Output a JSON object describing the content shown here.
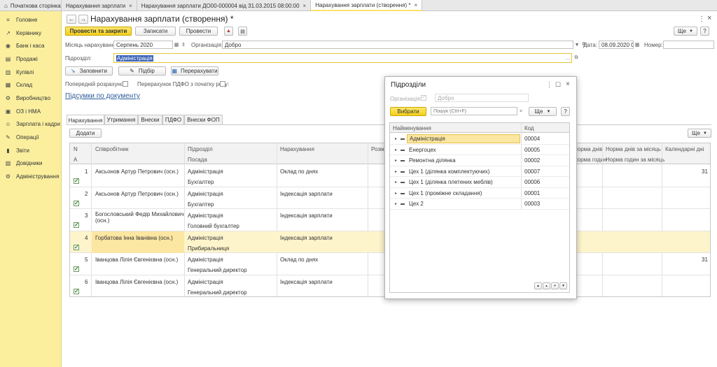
{
  "tabs": [
    {
      "label": "Початкова сторінка",
      "close": ""
    },
    {
      "label": "Нарахування зарплати",
      "close": "×"
    },
    {
      "label": "Нарахування зарплати ДО00-000004 від 31.03.2015 08:00:00",
      "close": "×"
    },
    {
      "label": "Нарахування зарплати (створення) *",
      "close": "×"
    }
  ],
  "sidebar": {
    "items": [
      {
        "label": "Головне",
        "icon": "≡"
      },
      {
        "label": "Керівнику",
        "icon": "↗"
      },
      {
        "label": "Банк і каса",
        "icon": "◉"
      },
      {
        "label": "Продажі",
        "icon": "▤"
      },
      {
        "label": "Купівлі",
        "icon": "▥"
      },
      {
        "label": "Склад",
        "icon": "▦"
      },
      {
        "label": "Виробництво",
        "icon": "⚙"
      },
      {
        "label": "ОЗ і НМА",
        "icon": "▣"
      },
      {
        "label": "Зарплата і кадри",
        "icon": "☺"
      },
      {
        "label": "Операції",
        "icon": "✎"
      },
      {
        "label": "Звіти",
        "icon": "▮"
      },
      {
        "label": "Довідники",
        "icon": "▧"
      },
      {
        "label": "Адміністрування",
        "icon": "⚙"
      }
    ]
  },
  "header": {
    "back": "←",
    "forward": "→",
    "title": "Нарахування зарплати (створення) *",
    "more_dots": "⋮",
    "close": "×"
  },
  "toolbar": {
    "post_close": "Провести та закрити",
    "save": "Записати",
    "post": "Провести",
    "more": "Ще",
    "help": "?"
  },
  "form": {
    "month_label": "Місяць нарахування:",
    "month_value": "Серпень 2020",
    "org_label": "Організація:",
    "org_value": "Добро",
    "date_label": "Дата:",
    "date_value": "08.09.2020 0...",
    "number_label": "Номер:",
    "number_value": "",
    "division_label": "Підрозділ:",
    "division_value": "Адміністрація"
  },
  "actions": {
    "fill": "Заповнити",
    "pick": "Підбір",
    "recalc": "Перерахувати"
  },
  "options": {
    "prelim_label": "Попередній розрахунок:",
    "pdfo_label": "Перерахунок ПДФО з початку року:"
  },
  "summary_link": "Підсумки по документу",
  "doc_tabs": [
    "Нарахування",
    "Утримання",
    "Внески",
    "ПДФО",
    "Внески ФОП"
  ],
  "grid": {
    "add": "Додати",
    "more": "Ще",
    "headers": {
      "n": "N",
      "a": "А",
      "employee": "Співробітник",
      "division": "Підрозділ",
      "position": "Посада",
      "accrual": "Нарахування",
      "size": "Розмі",
      "norm_days": "Норма днів",
      "norm_hours": "Норма годин",
      "norm_days_month": "Норма днів за місяць",
      "norm_hours_month": "Норма годин за місяць",
      "cal_days": "Календарні дні"
    },
    "rows": [
      {
        "n": "1",
        "employee": "Аксьонов Артур Петрович (осн.)",
        "employee2": "",
        "division": "Адміністрація",
        "position": "Бухгалтер",
        "accrual": "Оклад по днях",
        "cal": "31"
      },
      {
        "n": "2",
        "employee": "Аксьонов Артур Петрович (осн.)",
        "employee2": "",
        "division": "Адміністрація",
        "position": "Бухгалтер",
        "accrual": "Індексація зарплати",
        "cal": ""
      },
      {
        "n": "3",
        "employee": "Богословський Федір Михайлович",
        "employee2": "(осн.)",
        "division": "Адміністрація",
        "position": "Головний бухгалтер",
        "accrual": "Індексація зарплати",
        "cal": ""
      },
      {
        "n": "4",
        "employee": "Горбатова Інна Іванівна (осн.)",
        "employee2": "",
        "division": "Адміністрація",
        "position": "Прибиральниця",
        "accrual": "Індексація зарплати",
        "cal": ""
      },
      {
        "n": "5",
        "employee": "Іванцова Лілія Євгенієвна (осн.)",
        "employee2": "",
        "division": "Адміністрація",
        "position": "Генеральний директор",
        "accrual": "Оклад по днях",
        "cal": "31"
      },
      {
        "n": "6",
        "employee": "Іванцова Лілія Євгенієвна (осн.)",
        "employee2": "",
        "division": "Адміністрація",
        "position": "Генеральний директор",
        "accrual": "Індексація зарплати",
        "cal": ""
      }
    ]
  },
  "dialog": {
    "title": "Підрозділи",
    "org_label": "Організація:",
    "org_value": "Добро",
    "select": "Вибрати",
    "search_placeholder": "Пошук (Ctrl+F)",
    "more": "Ще",
    "help": "?",
    "col_name": "Найменування",
    "col_code": "Код",
    "rows": [
      {
        "name": "Адміністрація",
        "code": "00004"
      },
      {
        "name": "Енергоцех",
        "code": "00005"
      },
      {
        "name": "Ремонтна ділянка",
        "code": "00002"
      },
      {
        "name": "Цех 1 (ділянка комплектуючих)",
        "code": "00007"
      },
      {
        "name": "Цех 1 (ділянка плетених меблів)",
        "code": "00006"
      },
      {
        "name": "Цех 1 (проміжне складання)",
        "code": "00001"
      },
      {
        "name": "Цех 2",
        "code": "00003"
      }
    ]
  }
}
